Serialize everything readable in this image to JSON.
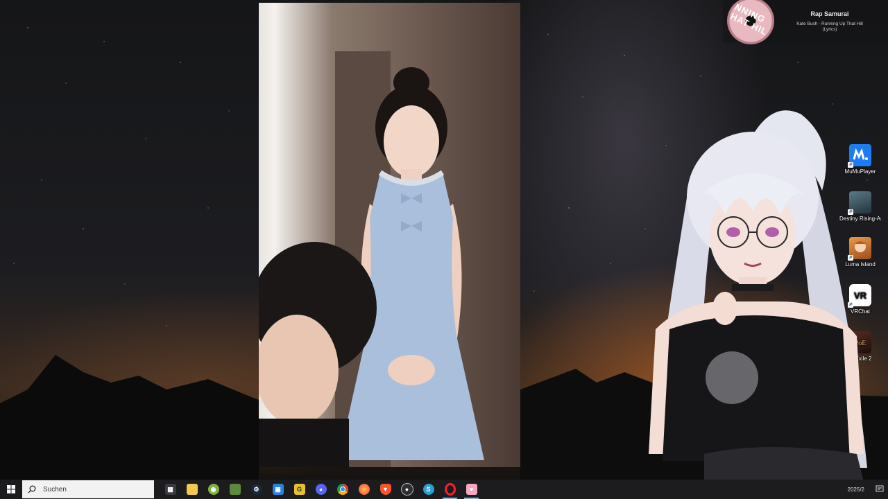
{
  "now_playing": {
    "title": "Rap Samurai",
    "subtitle_line1": "Kate Bush - Running Up That Hill",
    "subtitle_line2": "(Lyrics)",
    "album_text": "NNING HAT HIL"
  },
  "desktop_icons": [
    {
      "label": "MuMuPlayer",
      "icon": "mumuplayer-icon",
      "color": "#1e7cf2"
    },
    {
      "label": "Destiny Rising-Andro...",
      "icon": "destiny-icon",
      "color": "#3f5663"
    },
    {
      "label": "Luma Island",
      "icon": "luma-island-icon",
      "color": "#c8742e"
    },
    {
      "label": "VRChat",
      "icon": "vrchat-icon",
      "color": "#ffffff"
    },
    {
      "label": "of Exile 2",
      "icon": "path-of-exile-icon",
      "color": "#3a1e1a"
    }
  ],
  "taskbar": {
    "search_placeholder": "Suchen",
    "apps": [
      {
        "name": "task-view",
        "color": "#2e2e33"
      },
      {
        "name": "file-explorer",
        "color": "#f2c94c"
      },
      {
        "name": "android-app",
        "color": "#7cb342"
      },
      {
        "name": "minecraft",
        "color": "#5d8a3a"
      },
      {
        "name": "steam",
        "color": "#1b2838"
      },
      {
        "name": "store",
        "color": "#2a82da"
      },
      {
        "name": "grammarly-g",
        "color": "#e8c02e"
      },
      {
        "name": "discord",
        "color": "#5865f2"
      },
      {
        "name": "chrome",
        "color": "#db4437"
      },
      {
        "name": "firefox",
        "color": "#ff7139"
      },
      {
        "name": "brave",
        "color": "#fb542b"
      },
      {
        "name": "obs",
        "color": "#302e31"
      },
      {
        "name": "vs-code-like",
        "color": "#2a9fd6"
      },
      {
        "name": "opera",
        "color": "#ff1b2d"
      },
      {
        "name": "pink-app",
        "color": "#f6a6c1"
      }
    ],
    "clock": "2025/2"
  }
}
